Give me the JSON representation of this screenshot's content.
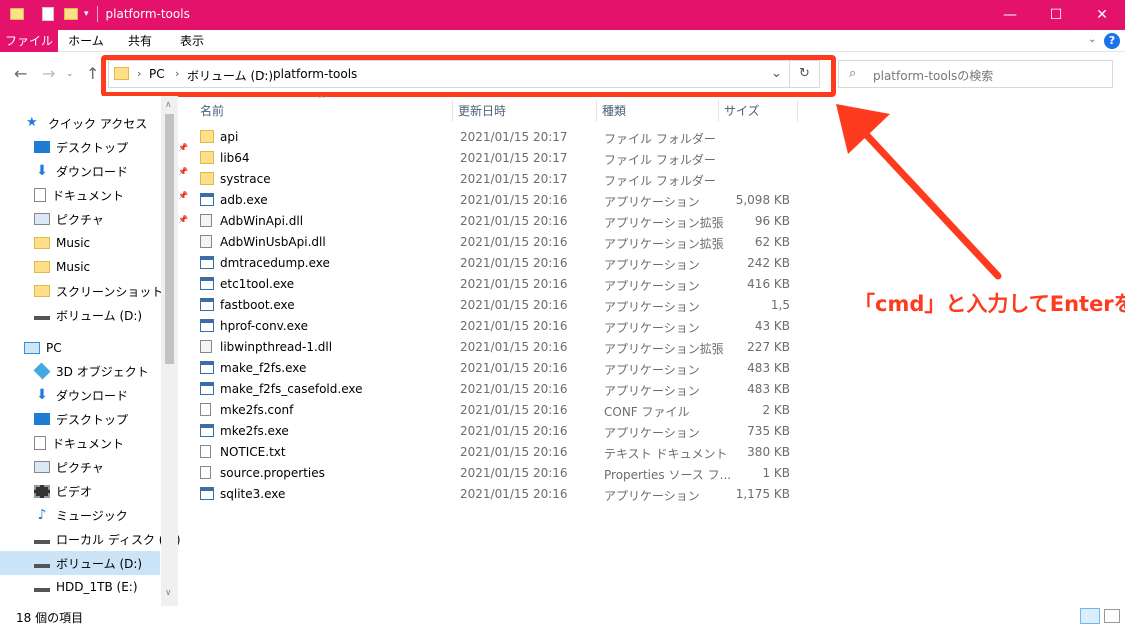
{
  "window": {
    "title": "platform-tools",
    "accent": "#e4126b",
    "controls": [
      "—",
      "☐",
      "✕"
    ]
  },
  "ribbon": {
    "tabs": [
      "ファイル",
      "ホーム",
      "共有",
      "表示"
    ]
  },
  "address": {
    "crumbs": [
      "PC",
      "ボリューム (D:)",
      "platform-tools"
    ],
    "refresh_icon": "refresh-icon"
  },
  "search": {
    "placeholder": "platform-toolsの検索"
  },
  "sidebar": {
    "quick_access_label": "クイック アクセス",
    "quick_items": [
      {
        "label": "デスクトップ",
        "icon": "desktop-icon",
        "pinned": true
      },
      {
        "label": "ダウンロード",
        "icon": "download-icon",
        "pinned": true
      },
      {
        "label": "ドキュメント",
        "icon": "document-icon",
        "pinned": true
      },
      {
        "label": "ピクチャ",
        "icon": "pictures-icon",
        "pinned": true
      },
      {
        "label": "Music",
        "icon": "folder-icon",
        "pinned": false
      },
      {
        "label": "Music",
        "icon": "folder-icon",
        "pinned": false
      },
      {
        "label": "スクリーンショット",
        "icon": "folder-icon",
        "pinned": false
      },
      {
        "label": "ボリューム (D:)",
        "icon": "drive-icon",
        "pinned": false
      }
    ],
    "pc_label": "PC",
    "pc_items": [
      {
        "label": "3D オブジェクト",
        "icon": "3d-objects-icon"
      },
      {
        "label": "ダウンロード",
        "icon": "download-icon"
      },
      {
        "label": "デスクトップ",
        "icon": "desktop-icon"
      },
      {
        "label": "ドキュメント",
        "icon": "document-icon"
      },
      {
        "label": "ピクチャ",
        "icon": "pictures-icon"
      },
      {
        "label": "ビデオ",
        "icon": "video-icon"
      },
      {
        "label": "ミュージック",
        "icon": "music-icon"
      },
      {
        "label": "ローカル ディスク (C:)",
        "icon": "drive-icon"
      },
      {
        "label": "ボリューム (D:)",
        "icon": "drive-icon",
        "selected": true
      },
      {
        "label": "HDD_1TB (E:)",
        "icon": "drive-icon"
      }
    ]
  },
  "columns": {
    "name": "名前",
    "modified": "更新日時",
    "type": "種類",
    "size": "サイズ"
  },
  "files": [
    {
      "name": "api",
      "date": "2021/01/15 20:17",
      "type": "ファイル フォルダー",
      "size": "",
      "icon": "folder-icon"
    },
    {
      "name": "lib64",
      "date": "2021/01/15 20:17",
      "type": "ファイル フォルダー",
      "size": "",
      "icon": "folder-icon"
    },
    {
      "name": "systrace",
      "date": "2021/01/15 20:17",
      "type": "ファイル フォルダー",
      "size": "",
      "icon": "folder-icon"
    },
    {
      "name": "adb.exe",
      "date": "2021/01/15 20:16",
      "type": "アプリケーション",
      "size": "5,098 KB",
      "icon": "exe-icon"
    },
    {
      "name": "AdbWinApi.dll",
      "date": "2021/01/15 20:16",
      "type": "アプリケーション拡張",
      "size": "96 KB",
      "icon": "dll-icon"
    },
    {
      "name": "AdbWinUsbApi.dll",
      "date": "2021/01/15 20:16",
      "type": "アプリケーション拡張",
      "size": "62 KB",
      "icon": "dll-icon"
    },
    {
      "name": "dmtracedump.exe",
      "date": "2021/01/15 20:16",
      "type": "アプリケーション",
      "size": "242 KB",
      "icon": "exe-icon"
    },
    {
      "name": "etc1tool.exe",
      "date": "2021/01/15 20:16",
      "type": "アプリケーション",
      "size": "416 KB",
      "icon": "exe-icon"
    },
    {
      "name": "fastboot.exe",
      "date": "2021/01/15 20:16",
      "type": "アプリケーション",
      "size": "1,5",
      "icon": "exe-icon"
    },
    {
      "name": "hprof-conv.exe",
      "date": "2021/01/15 20:16",
      "type": "アプリケーション",
      "size": "43 KB",
      "icon": "exe-icon"
    },
    {
      "name": "libwinpthread-1.dll",
      "date": "2021/01/15 20:16",
      "type": "アプリケーション拡張",
      "size": "227 KB",
      "icon": "dll-icon"
    },
    {
      "name": "make_f2fs.exe",
      "date": "2021/01/15 20:16",
      "type": "アプリケーション",
      "size": "483 KB",
      "icon": "exe-icon"
    },
    {
      "name": "make_f2fs_casefold.exe",
      "date": "2021/01/15 20:16",
      "type": "アプリケーション",
      "size": "483 KB",
      "icon": "exe-icon"
    },
    {
      "name": "mke2fs.conf",
      "date": "2021/01/15 20:16",
      "type": "CONF ファイル",
      "size": "2 KB",
      "icon": "file-icon"
    },
    {
      "name": "mke2fs.exe",
      "date": "2021/01/15 20:16",
      "type": "アプリケーション",
      "size": "735 KB",
      "icon": "exe-icon"
    },
    {
      "name": "NOTICE.txt",
      "date": "2021/01/15 20:16",
      "type": "テキスト ドキュメント",
      "size": "380 KB",
      "icon": "file-icon"
    },
    {
      "name": "source.properties",
      "date": "2021/01/15 20:16",
      "type": "Properties ソース フ...",
      "size": "1 KB",
      "icon": "file-icon"
    },
    {
      "name": "sqlite3.exe",
      "date": "2021/01/15 20:16",
      "type": "アプリケーション",
      "size": "1,175 KB",
      "icon": "exe-icon"
    }
  ],
  "status": {
    "count": "18 個の項目"
  },
  "annotation": {
    "text": "「cmd」と入力してEnterを押下",
    "color": "#ff3b1f"
  }
}
